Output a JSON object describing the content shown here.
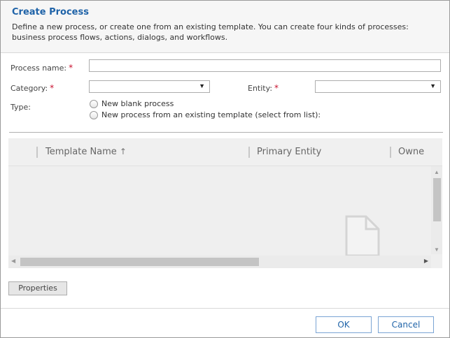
{
  "dialog": {
    "title": "Create Process",
    "description": "Define a new process, or create one from an existing template. You can create four kinds of processes: business process flows, actions, dialogs, and workflows."
  },
  "form": {
    "process_name_label": "Process name:",
    "process_name_value": "",
    "category_label": "Category:",
    "category_value": "",
    "entity_label": "Entity:",
    "entity_value": "",
    "required_marker": "*",
    "type_label": "Type:",
    "type_options": [
      "New blank process",
      "New process from an existing template (select from list):"
    ],
    "dropdown_arrow": "▼"
  },
  "grid": {
    "columns": [
      "Template Name",
      "Primary Entity",
      "Owne"
    ],
    "sort_indicator": "↑",
    "rows": []
  },
  "buttons": {
    "properties": "Properties",
    "ok": "OK",
    "cancel": "Cancel"
  },
  "icons": {
    "empty_state": "document-icon",
    "scroll_up": "▲",
    "scroll_down": "▼",
    "scroll_left": "◀",
    "scroll_right": "▶"
  },
  "colors": {
    "title": "#1f63a8",
    "required": "#c8102e",
    "button_border": "#7aa4d4"
  }
}
